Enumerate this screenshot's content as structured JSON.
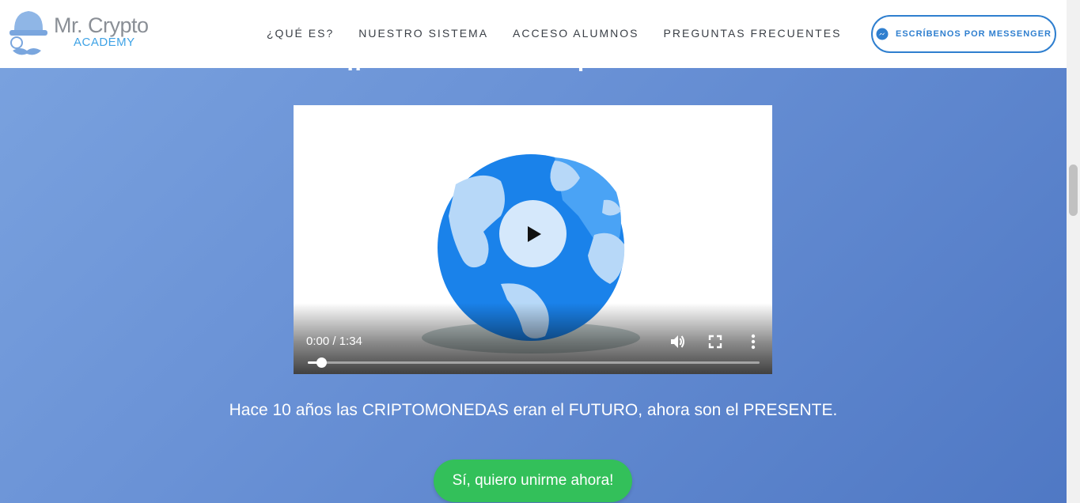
{
  "header": {
    "logo": {
      "title": "Mr. Crypto",
      "subtitle": "ACADEMY"
    },
    "nav": [
      {
        "label": "¿QUÉ ES?"
      },
      {
        "label": "NUESTRO SISTEMA"
      },
      {
        "label": "ACCESO ALUMNOS"
      },
      {
        "label": "PREGUNTAS FRECUENTES"
      }
    ],
    "messenger_button": {
      "label": "ESCRÍBENOS POR MESSENGER",
      "icon": "messenger-icon"
    }
  },
  "hero": {
    "heading": "¡¡ Bienvenidos al 'Experimento' !!",
    "video": {
      "time": "0:00 / 1:34",
      "progress": 0.03,
      "controls": [
        "play-icon",
        "volume-icon",
        "fullscreen-icon",
        "more-options-icon"
      ]
    },
    "tagline": "Hace 10 años las CRIPTOMONEDAS eran el FUTURO, ahora son el PRESENTE.",
    "cta_label": "Sí, quiero unirme ahora!"
  },
  "colors": {
    "accent": "#2f7fcf",
    "cta": "#33c05a",
    "background": "#6a92d6"
  }
}
